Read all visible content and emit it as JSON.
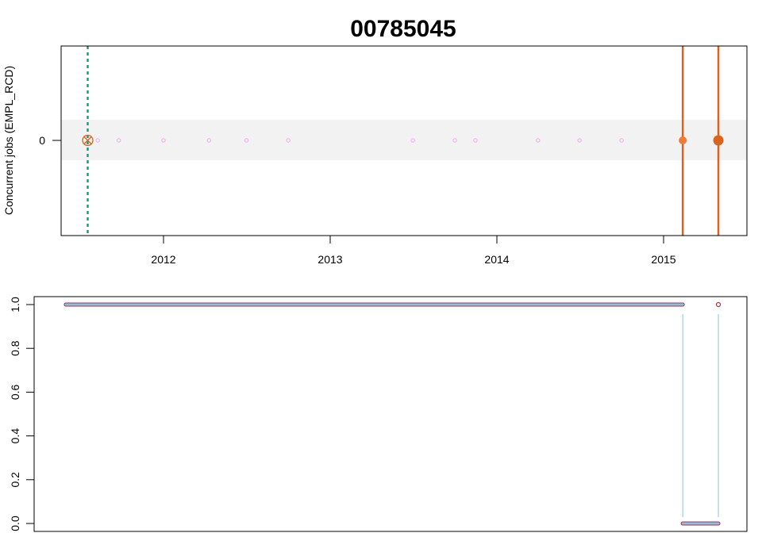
{
  "chart_data": [
    {
      "type": "scatter",
      "title": "00785045",
      "ylabel": "Concurrent jobs (EMPL_RCD)",
      "xlabel": "",
      "x_axis": {
        "type": "date",
        "ticks": [
          "2012",
          "2013",
          "2014",
          "2015"
        ]
      },
      "y_axis": {
        "ticks": [
          "0"
        ]
      },
      "band": {
        "ymin": -0.25,
        "ymax": 0.25,
        "color": "#f2f2f2"
      },
      "series": [
        {
          "marker": "open-circle-small",
          "color": "#f5a6f0",
          "points": [
            {
              "date": "2011-08-10",
              "y": 0
            },
            {
              "date": "2011-09-25",
              "y": 0
            },
            {
              "date": "2012-01-01",
              "y": 0
            },
            {
              "date": "2012-04-10",
              "y": 0
            },
            {
              "date": "2012-07-01",
              "y": 0
            },
            {
              "date": "2012-10-01",
              "y": 0
            },
            {
              "date": "2013-07-01",
              "y": 0
            },
            {
              "date": "2013-10-01",
              "y": 0
            },
            {
              "date": "2013-11-15",
              "y": 0
            },
            {
              "date": "2014-04-01",
              "y": 0
            },
            {
              "date": "2014-07-01",
              "y": 0
            },
            {
              "date": "2014-10-01",
              "y": 0
            }
          ]
        },
        {
          "marker": "open-circle-x",
          "color": "#d9621f",
          "points": [
            {
              "date": "2011-07-19",
              "y": 0
            }
          ]
        },
        {
          "marker": "filled-circle",
          "color": "#f07a3a",
          "points": [
            {
              "date": "2015-02-12",
              "y": 0
            }
          ]
        },
        {
          "marker": "filled-circle-large",
          "color": "#d9621f",
          "points": [
            {
              "date": "2015-05-01",
              "y": 0
            }
          ]
        }
      ],
      "vlines": [
        {
          "date": "2011-07-19",
          "style": "dotted",
          "color": "#1b9e77"
        },
        {
          "date": "2015-02-12",
          "style": "solid",
          "color": "#d9621f"
        },
        {
          "date": "2015-05-01",
          "style": "solid",
          "color": "#d9621f"
        }
      ]
    },
    {
      "type": "line",
      "y_axis": {
        "ticks": [
          "0.0",
          "0.2",
          "0.4",
          "0.6",
          "0.8",
          "1.0"
        ],
        "ylim": [
          0,
          1
        ]
      },
      "segments": [
        {
          "from": "2011-06-01",
          "to": "2015-02-12",
          "y": 1
        },
        {
          "from": "2015-02-12",
          "to": "2015-05-01",
          "y": 0
        }
      ],
      "transitions": [
        {
          "date": "2015-02-12",
          "from": 1,
          "to": 0
        },
        {
          "date": "2015-05-01",
          "from": 0,
          "to": 1
        }
      ],
      "points": [
        {
          "date": "2015-05-01",
          "y": 1
        }
      ],
      "line_color": "#87c3e6",
      "edge_color": "#b03040"
    }
  ]
}
